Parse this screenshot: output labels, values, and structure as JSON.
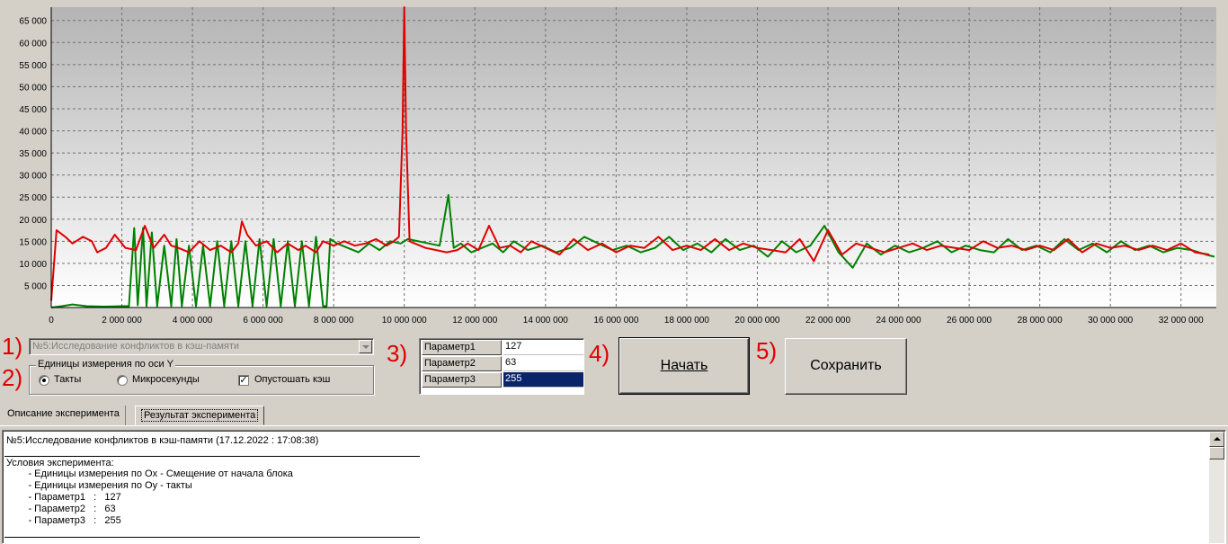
{
  "chart_data": {
    "type": "line",
    "title": "",
    "xlabel": "",
    "ylabel": "",
    "xlim": [
      0,
      33000000
    ],
    "ylim": [
      0,
      68000
    ],
    "grid": true,
    "x_ticks": [
      0,
      2000000,
      4000000,
      6000000,
      8000000,
      10000000,
      12000000,
      14000000,
      16000000,
      18000000,
      20000000,
      22000000,
      24000000,
      26000000,
      28000000,
      30000000,
      32000000
    ],
    "x_tick_labels": [
      "0",
      "2 000 000",
      "4 000 000",
      "6 000 000",
      "8 000 000",
      "10 000 000",
      "12 000 000",
      "14 000 000",
      "16 000 000",
      "18 000 000",
      "20 000 000",
      "22 000 000",
      "24 000 000",
      "26 000 000",
      "28 000 000",
      "30 000 000",
      "32 000 000"
    ],
    "y_ticks": [
      5000,
      10000,
      15000,
      20000,
      25000,
      30000,
      35000,
      40000,
      45000,
      50000,
      55000,
      60000,
      65000
    ],
    "y_tick_labels": [
      "5 000",
      "10 000",
      "15 000",
      "20 000",
      "25 000",
      "30 000",
      "35 000",
      "40 000",
      "45 000",
      "50 000",
      "55 000",
      "60 000",
      "65 000"
    ],
    "series": [
      {
        "color": "#e00000",
        "x": [
          0,
          150000,
          400000,
          600000,
          900000,
          1150000,
          1300000,
          1550000,
          1800000,
          2100000,
          2400000,
          2650000,
          2900000,
          3200000,
          3400000,
          3600000,
          3900000,
          4200000,
          4500000,
          4800000,
          5100000,
          5300000,
          5400000,
          5550000,
          5800000,
          6100000,
          6400000,
          6700000,
          7000000,
          7200000,
          7500000,
          7700000,
          8000000,
          8300000,
          8600000,
          8900000,
          9200000,
          9500000,
          9700000,
          9850000,
          9950000,
          10000000,
          10050000,
          10150000,
          10300000,
          10600000,
          10900000,
          11200000,
          11500000,
          11800000,
          12100000,
          12400000,
          12700000,
          13000000,
          13300000,
          13600000,
          14000000,
          14400000,
          14800000,
          15200000,
          15600000,
          16000000,
          16400000,
          16800000,
          17200000,
          17600000,
          18000000,
          18400000,
          18800000,
          19200000,
          19600000,
          20000000,
          20400000,
          20800000,
          21200000,
          21600000,
          22000000,
          22400000,
          22800000,
          23200000,
          23600000,
          24000000,
          24400000,
          24800000,
          25200000,
          25600000,
          26000000,
          26400000,
          26800000,
          27200000,
          27600000,
          28000000,
          28400000,
          28800000,
          29200000,
          29600000,
          30000000,
          30400000,
          30800000,
          31200000,
          31600000,
          32000000,
          32400000,
          32800000
        ],
        "y": [
          1500,
          17500,
          16000,
          14500,
          16000,
          15000,
          12500,
          13500,
          16500,
          13500,
          13000,
          18500,
          13500,
          16500,
          14000,
          13500,
          12500,
          15000,
          13000,
          14000,
          12500,
          14500,
          19500,
          16500,
          14000,
          15000,
          12500,
          14500,
          13000,
          14000,
          12500,
          15000,
          14000,
          15000,
          14000,
          14500,
          15500,
          14000,
          15000,
          16000,
          40000,
          68000,
          40000,
          15000,
          14500,
          13500,
          13000,
          12500,
          13000,
          14500,
          13000,
          18500,
          13500,
          14000,
          12500,
          15000,
          13500,
          12000,
          15500,
          13000,
          14500,
          12500,
          14000,
          13500,
          16000,
          13000,
          14000,
          13000,
          15500,
          13000,
          14500,
          13500,
          13000,
          12500,
          15500,
          10500,
          17500,
          12000,
          14500,
          13500,
          12500,
          13500,
          14500,
          13000,
          14000,
          13500,
          13000,
          15000,
          13500,
          14000,
          13000,
          14000,
          13000,
          15500,
          12500,
          14500,
          13500,
          14000,
          13000,
          14000,
          13000,
          14500,
          12500,
          12000
        ]
      },
      {
        "color": "#008000",
        "x": [
          0,
          300000,
          600000,
          1000000,
          1500000,
          2000000,
          2150000,
          2200000,
          2350000,
          2450000,
          2600000,
          2700000,
          2850000,
          3000000,
          3200000,
          3400000,
          3550000,
          3700000,
          3900000,
          4100000,
          4300000,
          4500000,
          4700000,
          4900000,
          5100000,
          5300000,
          5500000,
          5700000,
          5900000,
          6100000,
          6300000,
          6500000,
          6700000,
          6900000,
          7100000,
          7300000,
          7500000,
          7700000,
          7800000,
          7900000,
          8100000,
          8400000,
          8700000,
          9000000,
          9300000,
          9600000,
          9900000,
          10100000,
          10400000,
          10700000,
          11000000,
          11250000,
          11400000,
          11600000,
          11900000,
          12200000,
          12500000,
          12800000,
          13100000,
          13500000,
          13900000,
          14300000,
          14700000,
          15100000,
          15500000,
          15900000,
          16300000,
          16700000,
          17100000,
          17500000,
          17900000,
          18300000,
          18700000,
          19100000,
          19500000,
          19900000,
          20300000,
          20700000,
          21100000,
          21500000,
          21900000,
          22300000,
          22700000,
          23100000,
          23500000,
          23900000,
          24300000,
          24700000,
          25100000,
          25500000,
          25900000,
          26300000,
          26700000,
          27100000,
          27500000,
          27900000,
          28300000,
          28700000,
          29100000,
          29500000,
          29900000,
          30300000,
          30700000,
          31100000,
          31500000,
          31900000,
          32300000,
          32700000,
          32950000
        ],
        "y": [
          0,
          300,
          700,
          300,
          200,
          300,
          300,
          300,
          18000,
          500,
          18000,
          300,
          17000,
          300,
          14000,
          300,
          15500,
          300,
          14000,
          300,
          14000,
          300,
          15000,
          300,
          15000,
          300,
          15000,
          300,
          15500,
          300,
          15500,
          300,
          15000,
          300,
          15000,
          300,
          16000,
          300,
          300,
          15500,
          14500,
          13500,
          12500,
          14500,
          13000,
          15000,
          14500,
          15500,
          15000,
          14500,
          14000,
          25500,
          13500,
          14500,
          12500,
          13500,
          14500,
          12500,
          15000,
          13000,
          14000,
          12500,
          13500,
          16000,
          14500,
          13000,
          14000,
          12500,
          13500,
          16000,
          13000,
          14500,
          12500,
          15500,
          13000,
          14000,
          11500,
          15000,
          12500,
          14000,
          18500,
          12500,
          9000,
          14500,
          12000,
          14000,
          12500,
          13500,
          15000,
          12500,
          14000,
          13000,
          12500,
          15500,
          13000,
          14000,
          12500,
          15500,
          13000,
          14500,
          12500,
          15000,
          13000,
          14000,
          12500,
          13500,
          13000,
          12000,
          11500
        ]
      }
    ]
  },
  "steps": {
    "s1": "1)",
    "s2": "2)",
    "s3": "3)",
    "s4": "4)",
    "s5": "5)"
  },
  "experiment_select": {
    "value": "№5:Исследование конфликтов в кэш-памяти"
  },
  "units_group": {
    "title": "Единицы измерения по оси Y",
    "options": [
      {
        "label": "Такты",
        "selected": true
      },
      {
        "label": "Микросекунды",
        "selected": false
      }
    ],
    "flush_cache": {
      "label": "Опустошать кэш",
      "checked": true,
      "mark": "✓"
    }
  },
  "params": [
    {
      "name": "Параметр1",
      "value": "127"
    },
    {
      "name": "Параметр2",
      "value": "63"
    },
    {
      "name": "Параметр3",
      "value": "255"
    }
  ],
  "buttons": {
    "start": "Начать",
    "save": "Сохранить"
  },
  "tabs": [
    {
      "label": "Описание эксперимента",
      "active": false
    },
    {
      "label": "Результат эксперимента",
      "active": true
    }
  ],
  "result": {
    "header": "№5:Исследование конфликтов в кэш-памяти (17.12.2022 : 17:08:38)",
    "lines": [
      "Условия эксперимента:",
      "        - Единицы измерения по Ox - Смещение от начала блока",
      "        - Единицы измерения по Oy - такты",
      "        - Параметр1   :   127",
      "        - Параметр2   :   63",
      "        - Параметр3   :   255"
    ]
  }
}
